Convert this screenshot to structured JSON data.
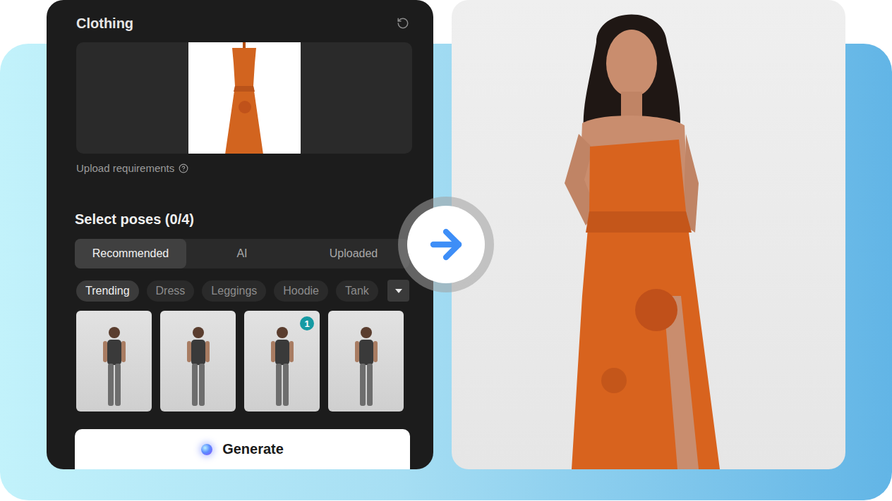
{
  "clothing": {
    "title": "Clothing",
    "upload_hint": "Upload requirements"
  },
  "poses": {
    "title": "Select poses (0/4)",
    "tabs": [
      {
        "label": "Recommended",
        "selected": true
      },
      {
        "label": "AI",
        "selected": false
      },
      {
        "label": "Uploaded",
        "selected": false
      }
    ],
    "categories": [
      {
        "label": "Trending",
        "selected": true
      },
      {
        "label": "Dress",
        "selected": false
      },
      {
        "label": "Leggings",
        "selected": false
      },
      {
        "label": "Hoodie",
        "selected": false
      },
      {
        "label": "Tank",
        "selected": false
      }
    ],
    "items": [
      {
        "selected": false,
        "badge": ""
      },
      {
        "selected": false,
        "badge": ""
      },
      {
        "selected": true,
        "badge": "1"
      },
      {
        "selected": false,
        "badge": ""
      }
    ]
  },
  "generate_button": "Generate"
}
